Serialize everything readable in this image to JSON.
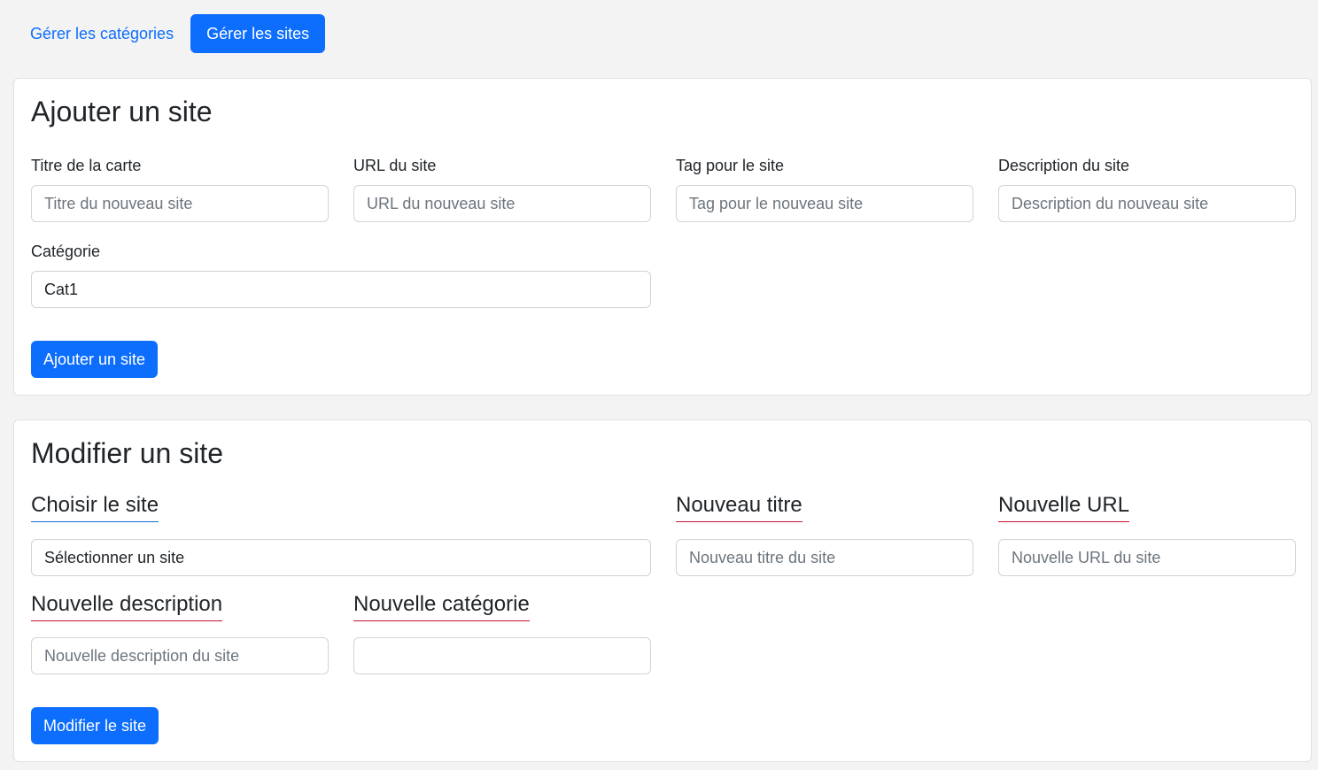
{
  "nav": {
    "categories_label": "Gérer les catégories",
    "sites_label": "Gérer les sites"
  },
  "add_site": {
    "title": "Ajouter un site",
    "card_title_label": "Titre de la carte",
    "card_title_placeholder": "Titre du nouveau site",
    "url_label": "URL du site",
    "url_placeholder": "URL du nouveau site",
    "tag_label": "Tag pour le site",
    "tag_placeholder": "Tag pour le nouveau site",
    "description_label": "Description du site",
    "description_placeholder": "Description du nouveau site",
    "category_label": "Catégorie",
    "category_value": "Cat1",
    "submit_label": "Ajouter un site"
  },
  "edit_site": {
    "title": "Modifier un site",
    "choose_label": "Choisir le site",
    "choose_value": "Sélectionner un site",
    "new_title_label": "Nouveau titre",
    "new_title_placeholder": "Nouveau titre du site",
    "new_url_label": "Nouvelle URL",
    "new_url_placeholder": "Nouvelle URL du site",
    "new_description_label": "Nouvelle description",
    "new_description_placeholder": "Nouvelle description du site",
    "new_category_label": "Nouvelle catégorie",
    "new_category_value": "",
    "submit_label": "Modifier le site"
  },
  "colors": {
    "primary": "#0d6efd",
    "background": "#f3f3f3",
    "underline_blue": "#1e6ad6",
    "underline_red": "#c8102e"
  }
}
